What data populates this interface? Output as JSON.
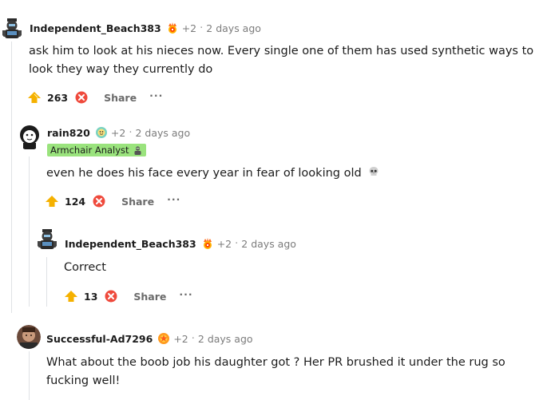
{
  "comments": [
    {
      "username": "Independent_Beach383",
      "award_count": "+2",
      "separator": "·",
      "time": "2 days ago",
      "body": "ask him to look at his nieces now. Every single one of them has used synthetic ways to look they way they currently do",
      "votes": "263",
      "share_label": "Share",
      "more_label": "···"
    },
    {
      "username": "rain820",
      "award_count": "+2",
      "separator": "·",
      "time": "2 days ago",
      "flair": "Armchair Analyst",
      "body": "even he does his face every year in fear of looking old",
      "votes": "124",
      "share_label": "Share",
      "more_label": "···"
    },
    {
      "username": "Independent_Beach383",
      "award_count": "+2",
      "separator": "·",
      "time": "2 days ago",
      "body": "Correct",
      "votes": "13",
      "share_label": "Share",
      "more_label": "···"
    },
    {
      "username": "Successful-Ad7296",
      "award_count": "+2",
      "separator": "·",
      "time": "2 days ago",
      "body": "What about the boob job his daughter got ? Her PR brushed it under the rug so fucking well!"
    }
  ],
  "colors": {
    "upvote": "#f5b100",
    "downvote": "#ef4a3c",
    "flair_bg": "#9ae37d",
    "rail": "#dfe2e5"
  },
  "icons": {
    "award": "award-icon",
    "skull": "skull-icon",
    "flair_emoji": "person-emoji-icon"
  }
}
